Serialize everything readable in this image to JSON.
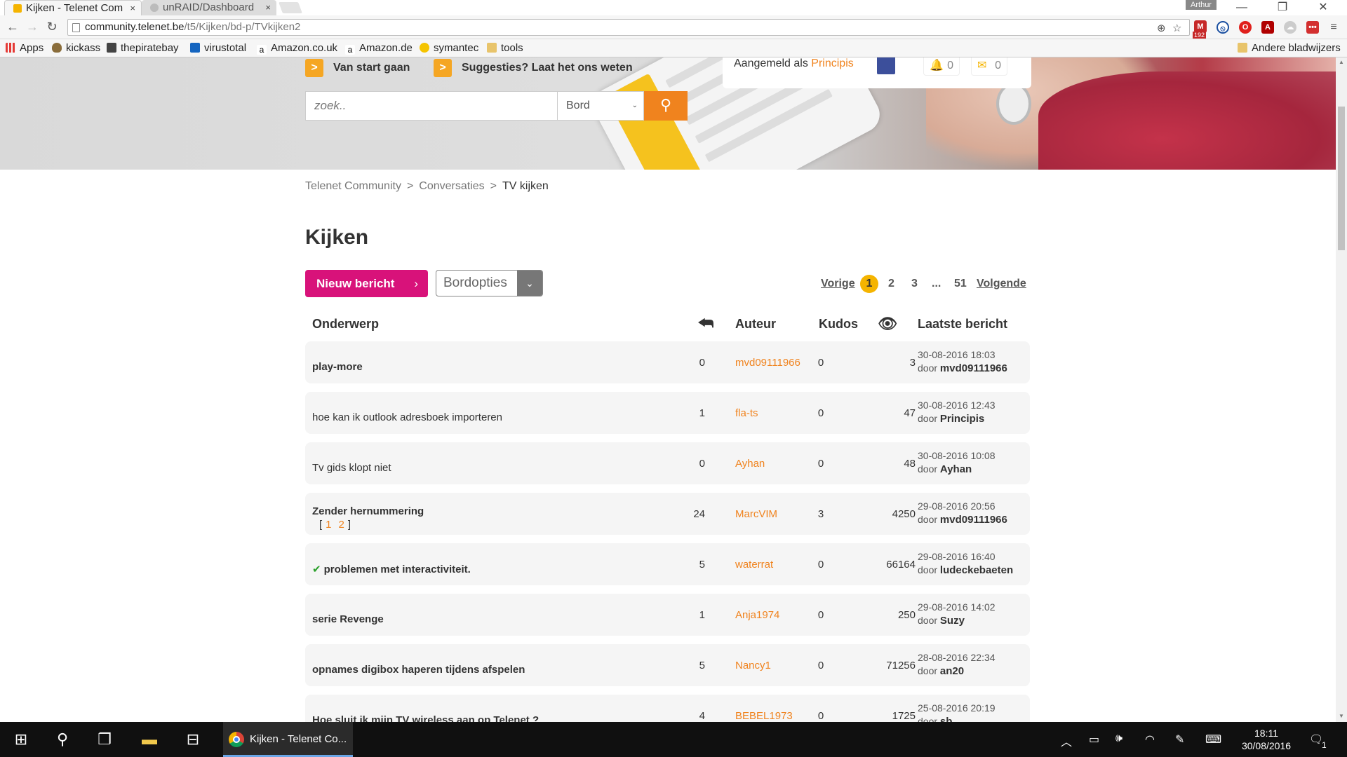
{
  "browser": {
    "tabs": [
      {
        "title": "Kijken - Telenet Com",
        "close": "×"
      },
      {
        "title": "unRAID/Dashboard",
        "close": "×"
      }
    ],
    "user": "Arthur",
    "window_controls": {
      "minimize": "—",
      "restore": "❐",
      "close": "✕"
    },
    "url_host": "community.telenet.be",
    "url_path": "/t5/Kijken/bd-p/TVkijken2",
    "bookmarks": [
      "Apps",
      "kickass",
      "thepiratebay",
      "virustotal",
      "Amazon.co.uk",
      "Amazon.de",
      "symantec",
      "tools"
    ],
    "other_bookmarks": "Andere bladwijzers",
    "extensions": [
      "192"
    ]
  },
  "header": {
    "promo_start": "Van start gaan",
    "promo_suggest": "Suggesties? Laat het ons weten",
    "signed_in_label": "Aangemeld als",
    "signed_in_user": "Principis",
    "notifications_count": "0",
    "messages_count": "0",
    "search_placeholder": "zoek..",
    "search_scope": "Bord"
  },
  "breadcrumb": {
    "items": [
      "Telenet Community",
      "Conversaties",
      "TV kijken"
    ],
    "separator": ">"
  },
  "board": {
    "title": "Kijken",
    "new_post": "Nieuw bericht",
    "board_options": "Bordopties"
  },
  "pager": {
    "prev": "Vorige",
    "pages": [
      "1",
      "2",
      "3"
    ],
    "ellipsis": "...",
    "last": "51",
    "next": "Volgende",
    "current": "1"
  },
  "table": {
    "headers": {
      "subject": "Onderwerp",
      "author": "Auteur",
      "kudos": "Kudos",
      "last": "Laatste bericht"
    },
    "by_prefix": "door",
    "rows": [
      {
        "subject": "play-more",
        "replies": "0",
        "author": "mvd09111966",
        "kudos": "0",
        "views": "3",
        "date": "30-08-2016 18:03",
        "by": "mvd09111966"
      },
      {
        "subject": "hoe kan ik outlook adresboek importeren",
        "replies": "1",
        "author": "fla-ts",
        "kudos": "0",
        "views": "47",
        "date": "30-08-2016 12:43",
        "by": "Principis"
      },
      {
        "subject": "Tv gids klopt niet",
        "replies": "0",
        "author": "Ayhan",
        "kudos": "0",
        "views": "48",
        "date": "30-08-2016 10:08",
        "by": "Ayhan"
      },
      {
        "subject": "Zender hernummering",
        "pages": [
          "1",
          "2"
        ],
        "replies": "24",
        "author": "MarcVIM",
        "kudos": "3",
        "views": "4250",
        "date": "29-08-2016 20:56",
        "by": "mvd09111966"
      },
      {
        "subject": "problemen met interactiviteit.",
        "solved": true,
        "replies": "5",
        "author": "waterrat",
        "kudos": "0",
        "views": "66164",
        "date": "29-08-2016 16:40",
        "by": "ludeckebaeten"
      },
      {
        "subject": "serie Revenge",
        "replies": "1",
        "author": "Anja1974",
        "kudos": "0",
        "views": "250",
        "date": "29-08-2016 14:02",
        "by": "Suzy"
      },
      {
        "subject": "opnames digibox haperen tijdens afspelen",
        "replies": "5",
        "author": "Nancy1",
        "kudos": "0",
        "views": "71256",
        "date": "28-08-2016 22:34",
        "by": "an20"
      },
      {
        "subject": "Hoe sluit ik mijn TV wireless aan op Telenet ?",
        "replies": "4",
        "author": "BEBEL1973",
        "kudos": "0",
        "views": "1725",
        "date": "25-08-2016 20:19",
        "by": "sb"
      }
    ]
  },
  "taskbar": {
    "app_title": "Kijken - Telenet Co...",
    "time": "18:11",
    "date": "30/08/2016",
    "notifications": "1"
  }
}
